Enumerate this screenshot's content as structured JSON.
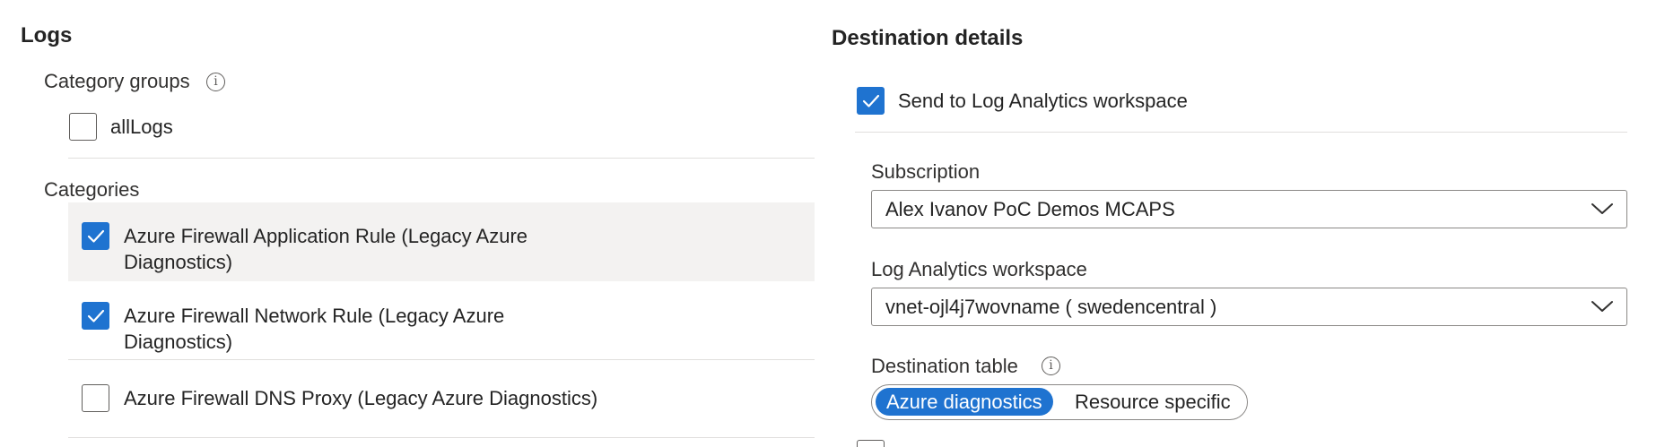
{
  "logs": {
    "title": "Logs",
    "category_groups_label": "Category groups",
    "info_glyph": "i",
    "groups": [
      {
        "label": "allLogs",
        "checked": false
      }
    ],
    "categories_label": "Categories",
    "categories": [
      {
        "label": "Azure Firewall Application Rule (Legacy Azure Diagnostics)",
        "checked": true
      },
      {
        "label": "Azure Firewall Network Rule (Legacy Azure Diagnostics)",
        "checked": true
      },
      {
        "label": "Azure Firewall DNS Proxy (Legacy Azure Diagnostics)",
        "checked": false
      }
    ]
  },
  "destination": {
    "title": "Destination details",
    "send_to_law_label": "Send to Log Analytics workspace",
    "send_to_law_checked": true,
    "subscription_label": "Subscription",
    "subscription_value": "Alex Ivanov PoC Demos MCAPS",
    "workspace_label": "Log Analytics workspace",
    "workspace_value": "vnet-ojl4j7wovname ( swedencentral )",
    "table_label": "Destination table",
    "info_glyph": "i",
    "table_options": [
      "Azure diagnostics",
      "Resource specific"
    ],
    "table_selected": "Azure diagnostics"
  },
  "colors": {
    "accent": "#1f73d0",
    "highlight_row": "#f3f2f1",
    "divider": "#e1dfdd"
  }
}
